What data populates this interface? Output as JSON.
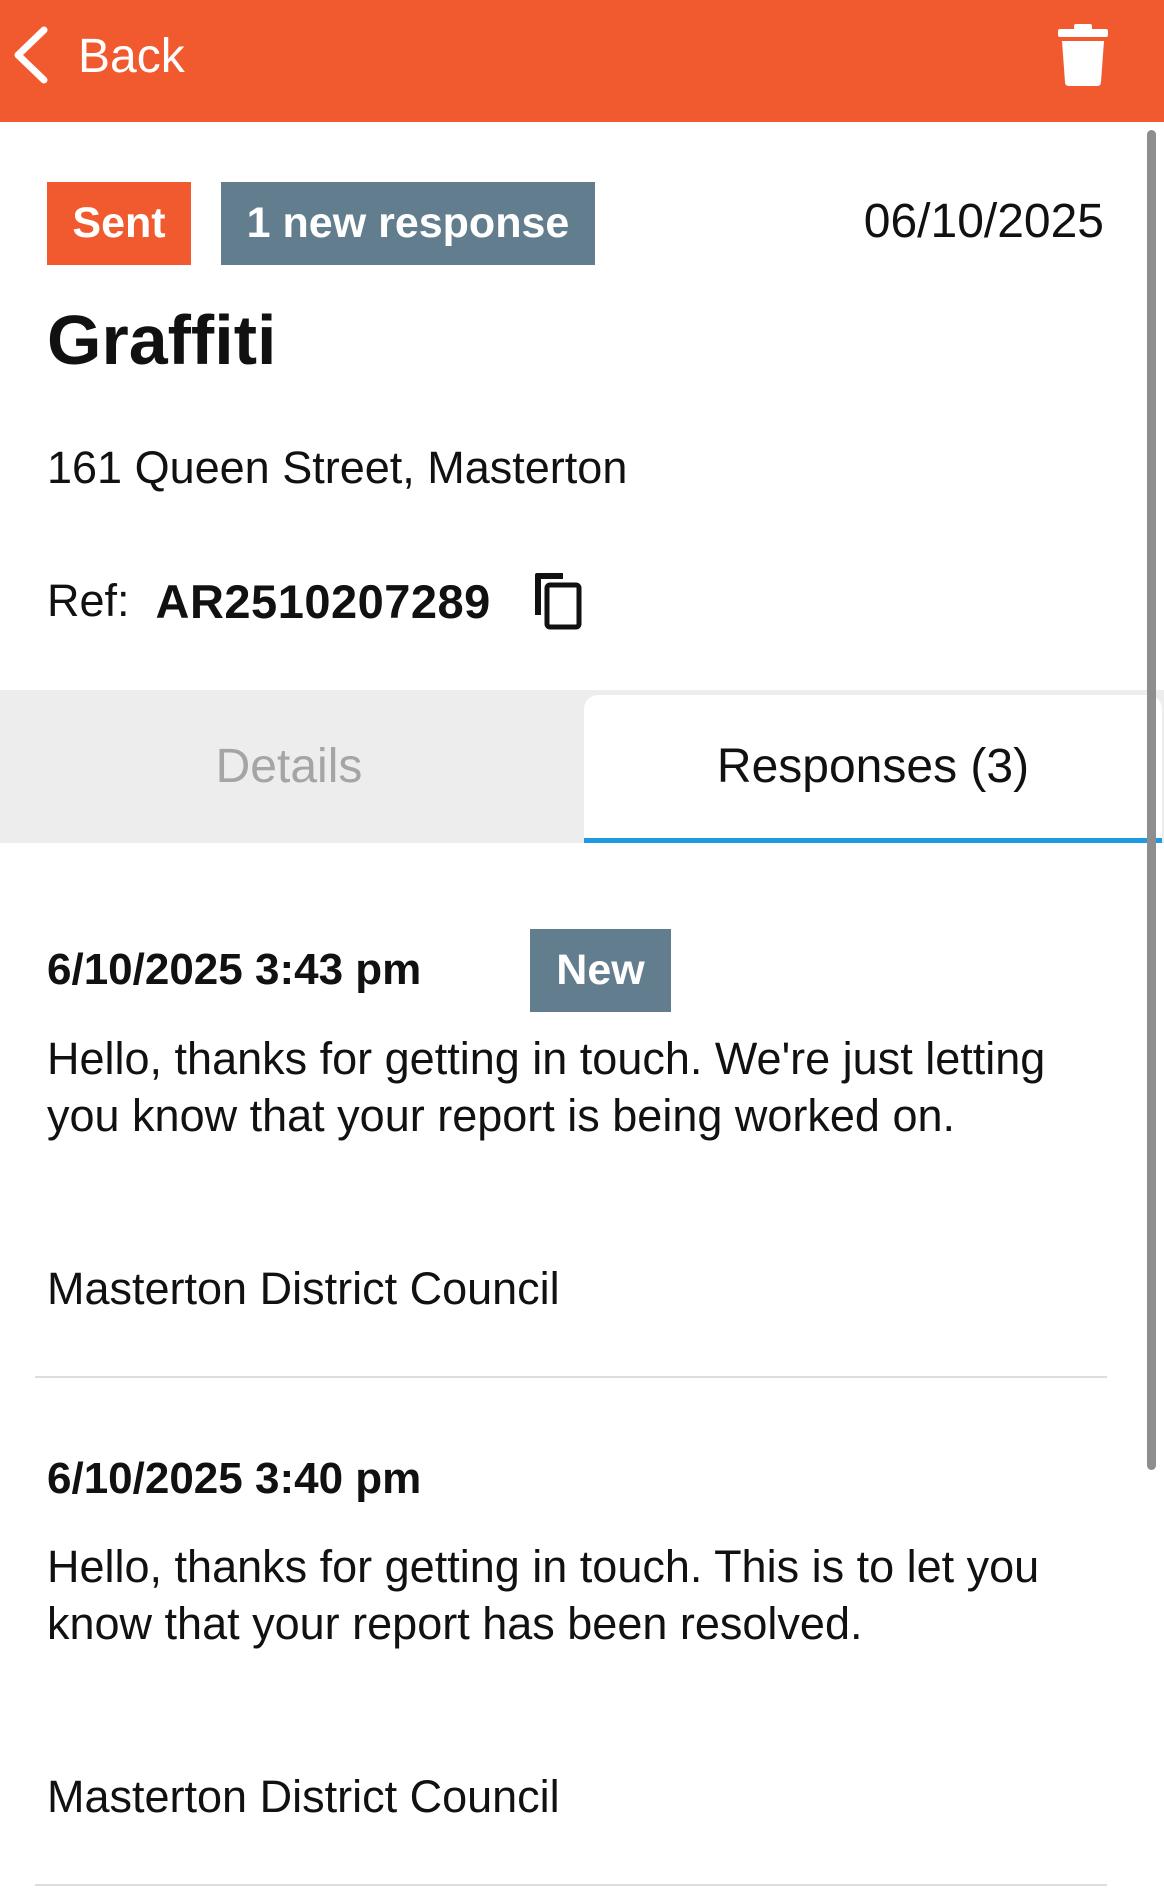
{
  "header": {
    "back_label": "Back",
    "back_icon": "chevron-left-icon",
    "delete_icon": "trash-icon"
  },
  "report": {
    "status_badge": "Sent",
    "responses_badge": "1 new response",
    "date": "06/10/2025",
    "title": "Graffiti",
    "address": "161 Queen Street, Masterton",
    "ref_label": "Ref:",
    "ref_value": "AR2510207289",
    "copy_icon": "copy-icon"
  },
  "tabs": [
    {
      "label": "Details",
      "active": false
    },
    {
      "label": "Responses (3)",
      "active": true
    }
  ],
  "responses": [
    {
      "date": "6/10/2025 3:43 pm",
      "badge": "New",
      "body": "Hello, thanks for getting in touch. We're just letting you know that your report is being worked on.",
      "signature": "Masterton District Council"
    },
    {
      "date": "6/10/2025 3:40 pm",
      "body": "Hello, thanks for getting in touch. This is to let you know that your report has been resolved.",
      "signature": "Masterton District Council"
    }
  ],
  "colors": {
    "accent": "#f15a2e",
    "badge_grey": "#627e8e",
    "tab_underline": "#1f9ade"
  }
}
